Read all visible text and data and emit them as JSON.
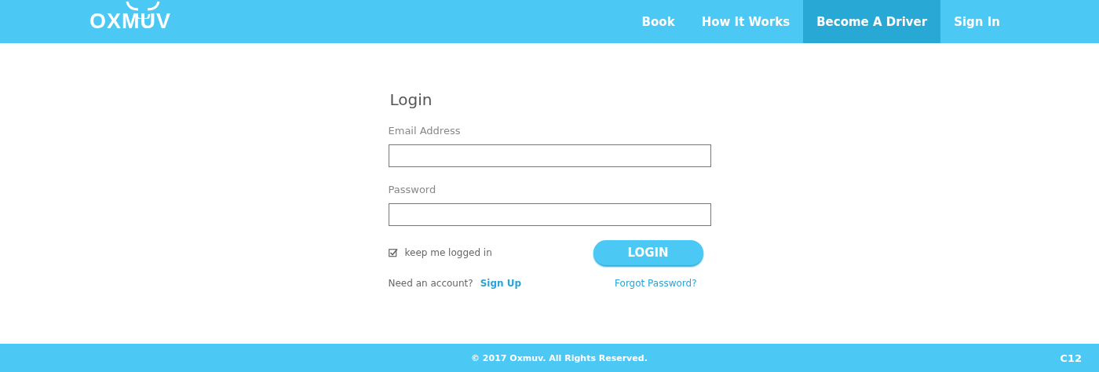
{
  "header": {
    "logo": "OXMUV",
    "nav": [
      {
        "label": "Book",
        "selected": false
      },
      {
        "label": "How It Works",
        "selected": false
      },
      {
        "label": "Become A Driver",
        "selected": true
      },
      {
        "label": "Sign In",
        "selected": false
      }
    ]
  },
  "login": {
    "title": "Login",
    "fields": [
      {
        "label": "Email Address"
      },
      {
        "label": "Password"
      }
    ],
    "remember": {
      "label": "keep me logged in",
      "checked": true
    },
    "submit": "LOGIN",
    "signup_prompt": "Need an account?",
    "signup_link": "Sign Up",
    "forgot_link": "Forgot Password?"
  },
  "footer": {
    "copyright": "© 2017 Oxmuv. All Rights Reserved.",
    "code": "C12"
  }
}
